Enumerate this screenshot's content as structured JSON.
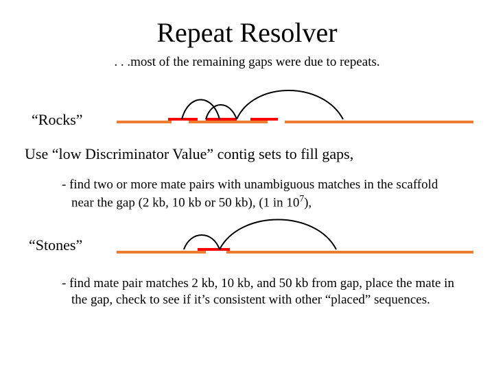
{
  "title": "Repeat Resolver",
  "subtitle": ". . .most of the remaining gaps were due to repeats.",
  "rocks": {
    "label": "“Rocks”",
    "use_line": "Use “low Discriminator Value” contig sets to fill gaps,",
    "detail_prefix": "- find two or more mate pairs with unambiguous matches in the scaffold near the gap (2 kb, 10 kb or 50 kb), (1 in 10",
    "detail_exp": "7",
    "detail_suffix": "),"
  },
  "stones": {
    "label": "“Stones”",
    "detail": "- find mate pair matches 2 kb, 10 kb, and 50 kb from gap, place the mate in the gap, check to see if it’s consistent with other “placed” sequences."
  },
  "colors": {
    "orange": "#ED7D31",
    "red": "#FF0000",
    "black": "#000000"
  },
  "chart_data": [
    {
      "type": "diagram",
      "name": "rocks-scaffold",
      "description": "Scaffold baseline with two gaps; three short red contigs above the baseline near the left gap; black arcs (mate-pair links) connecting positions across the scaffold."
    },
    {
      "type": "diagram",
      "name": "stones-scaffold",
      "description": "Scaffold baseline with one gap; one short red contig placed in/near the gap; two black arcs (mate-pair links) spanning across the gap."
    }
  ]
}
